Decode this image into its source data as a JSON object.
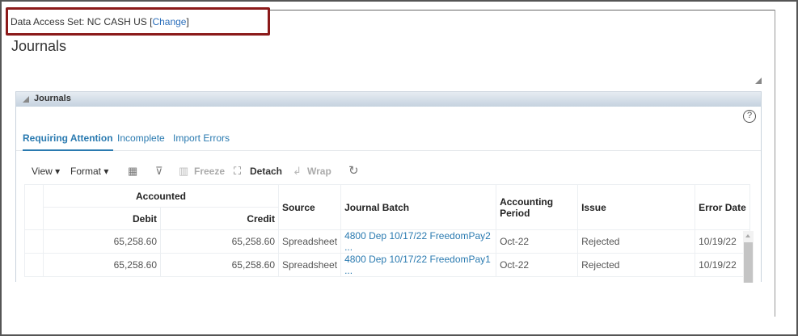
{
  "header": {
    "das_label": "Data Access Set:",
    "das_value": "NC CASH US",
    "change_open": "[",
    "change_link": "Change",
    "change_close": "]",
    "page_title": "Journals"
  },
  "panel": {
    "title": "Journals",
    "help": "?"
  },
  "tabs": [
    {
      "label": "Requiring Attention"
    },
    {
      "label": "Incomplete"
    },
    {
      "label": "Import Errors"
    }
  ],
  "toolbar": {
    "view": "View ▾",
    "format": "Format ▾",
    "freeze": "Freeze",
    "detach": "Detach",
    "wrap": "Wrap"
  },
  "table": {
    "group_header": "Accounted",
    "columns": {
      "debit": "Debit",
      "credit": "Credit",
      "source": "Source",
      "batch": "Journal Batch",
      "period": "Accounting Period",
      "issue": "Issue",
      "error_date": "Error Date"
    },
    "rows": [
      {
        "debit": "65,258.60",
        "credit": "65,258.60",
        "source": "Spreadsheet",
        "batch": "4800 Dep 10/17/22 FreedomPay2 ...",
        "period": "Oct-22",
        "issue": "Rejected",
        "error_date": "10/19/22"
      },
      {
        "debit": "65,258.60",
        "credit": "65,258.60",
        "source": "Spreadsheet",
        "batch": "4800 Dep 10/17/22 FreedomPay1 ...",
        "period": "Oct-22",
        "issue": "Rejected",
        "error_date": "10/19/22"
      }
    ]
  }
}
